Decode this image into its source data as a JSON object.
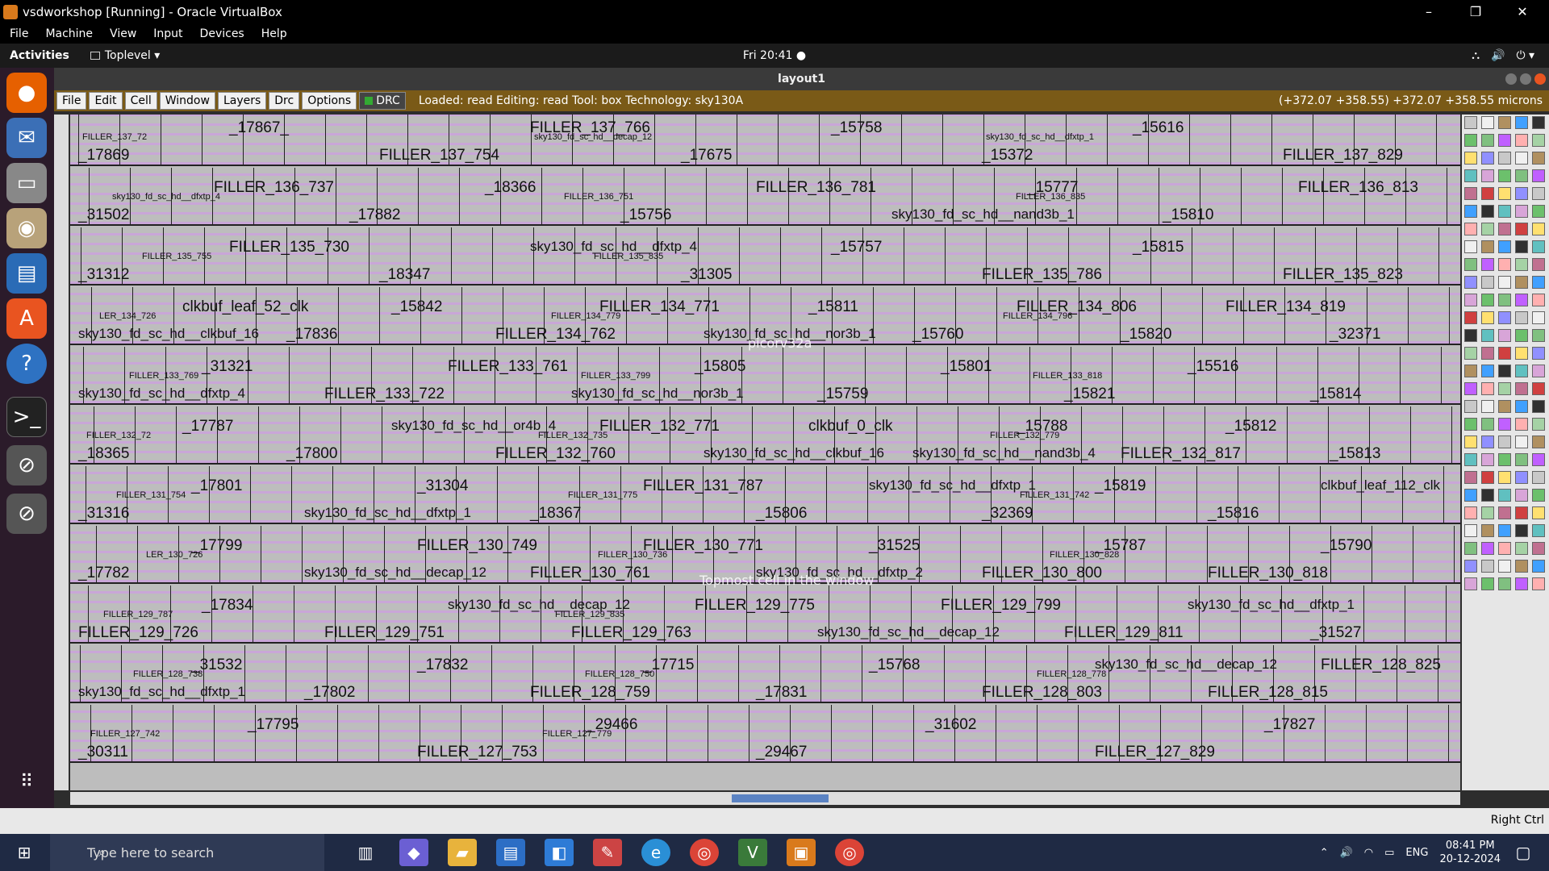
{
  "window": {
    "title": "vsdworkshop [Running] - Oracle VirtualBox",
    "minimize": "–",
    "maximize": "❐",
    "close": "✕"
  },
  "vb_menu": [
    "File",
    "Machine",
    "View",
    "Input",
    "Devices",
    "Help"
  ],
  "gnome": {
    "activities": "Activities",
    "toplevel": "Toplevel ▾",
    "clock": "Fri 20:41 ●",
    "sys_icons": [
      "⛬",
      "🔊",
      "⏻ ▾"
    ]
  },
  "magic": {
    "title": "layout1",
    "menu": [
      "File",
      "Edit",
      "Cell",
      "Window",
      "Layers",
      "Drc",
      "Options"
    ],
    "drc": "DRC",
    "status": "Loaded: read Editing: read Tool: box  Technology: sky130A",
    "coords": "(+372.07 +358.55) +372.07 +358.55 microns",
    "overlay_cell": "picorv32a",
    "overlay_hint": "Topmost cell in the window"
  },
  "rows": [
    {
      "big": [
        "_17869",
        "_17867_",
        "FILLER_137_754",
        "FILLER_137_766",
        "_17675",
        "_15758",
        "_15372",
        "_15616",
        "FILLER_137_829"
      ],
      "small": [
        "FILLER_137_72",
        "sky130_fd_sc_hd__decap_12",
        "sky130_fd_sc_hd__dfxtp_1"
      ]
    },
    {
      "big": [
        "_31502",
        "FILLER_136_737",
        "_17882",
        "_18366",
        "_15756",
        "FILLER_136_781",
        "sky130_fd_sc_hd__nand3b_1",
        "_15777",
        "_15810",
        "FILLER_136_813"
      ],
      "small": [
        "sky130_fd_sc_hd__dfxtp_4",
        "FILLER_136_751",
        "FILLER_136_835"
      ]
    },
    {
      "big": [
        "_31312",
        "FILLER_135_730",
        "_18347",
        "sky130_fd_sc_hd__dfxtp_4",
        "_31305",
        "_15757",
        "FILLER_135_786",
        "_15815",
        "FILLER_135_823"
      ],
      "small": [
        "FILLER_135_755",
        "FILLER_135_835"
      ]
    },
    {
      "big": [
        "sky130_fd_sc_hd__clkbuf_16",
        "clkbuf_leaf_52_clk",
        "_17836",
        "_15842",
        "FILLER_134_762",
        "FILLER_134_771",
        "sky130_fd_sc_hd__nor3b_1",
        "_15811",
        "_15760",
        "FILLER_134_806",
        "_15820",
        "FILLER_134_819",
        "_32371"
      ],
      "small": [
        "LER_134_726",
        "FILLER_134_779",
        "FILLER_134_796"
      ]
    },
    {
      "big": [
        "sky130_fd_sc_hd__dfxtp_4",
        "_31321",
        "FILLER_133_722",
        "FILLER_133_761",
        "sky130_fd_sc_hd__nor3b_1",
        "_15805",
        "_15759",
        "_15801",
        "_15821",
        "_15516",
        "_15814"
      ],
      "small": [
        "FILLER_133_769",
        "FILLER_133_799",
        "FILLER_133_818"
      ]
    },
    {
      "big": [
        "_18365",
        "_17787",
        "_17800",
        "sky130_fd_sc_hd__or4b_4",
        "FILLER_132_760",
        "FILLER_132_771",
        "sky130_fd_sc_hd__clkbuf_16",
        "clkbuf_0_clk",
        "sky130_fd_sc_hd__nand3b_4",
        "_15788",
        "FILLER_132_817",
        "_15812",
        "_15813"
      ],
      "small": [
        "FILLER_132_72",
        "FILLER_132_735",
        "FILLER_132_779"
      ]
    },
    {
      "big": [
        "_31316",
        "_17801",
        "sky130_fd_sc_hd__dfxtp_1",
        "_31304",
        "_18367",
        "FILLER_131_787",
        "_15806",
        "sky130_fd_sc_hd__dfxtp_1",
        "_32369",
        "_15819",
        "_15816",
        "clkbuf_leaf_112_clk"
      ],
      "small": [
        "FILLER_131_754",
        "FILLER_131_775",
        "FILLER_131_742"
      ]
    },
    {
      "big": [
        "_17782",
        "_17799",
        "sky130_fd_sc_hd__decap_12",
        "FILLER_130_749",
        "FILLER_130_761",
        "FILLER_130_771",
        "sky130_fd_sc_hd__dfxtp_2",
        "_31525",
        "FILLER_130_800",
        "_15787",
        "FILLER_130_818",
        "_15790"
      ],
      "small": [
        "LER_130_726",
        "FILLER_130_736",
        "FILLER_130_828"
      ]
    },
    {
      "big": [
        "FILLER_129_726",
        "_17834",
        "FILLER_129_751",
        "sky130_fd_sc_hd__decap_12",
        "FILLER_129_763",
        "FILLER_129_775",
        "sky130_fd_sc_hd__decap_12",
        "FILLER_129_799",
        "FILLER_129_811",
        "sky130_fd_sc_hd__dfxtp_1",
        "_31527"
      ],
      "small": [
        "FILLER_129_787",
        "FILLER_129_835"
      ]
    },
    {
      "big": [
        "sky130_fd_sc_hd__dfxtp_1",
        "_31532",
        "_17802",
        "_17832",
        "FILLER_128_759",
        "_17715",
        "_17831",
        "_15768",
        "FILLER_128_803",
        "sky130_fd_sc_hd__decap_12",
        "FILLER_128_815",
        "FILLER_128_825"
      ],
      "small": [
        "FILLER_128_738",
        "FILLER_128_750",
        "FILLER_128_778"
      ]
    },
    {
      "big": [
        "_30311",
        "_17795",
        "FILLER_127_753",
        "_29466",
        "_29467",
        "_31602",
        "FILLER_127_829",
        "_17827"
      ],
      "small": [
        "FILLER_127_742",
        "FILLER_127_779"
      ]
    }
  ],
  "vbox_status": {
    "right_ctrl": "Right Ctrl"
  },
  "taskbar": {
    "search_placeholder": "Type here to search",
    "time": "08:41 PM",
    "date": "20-12-2024",
    "lang": "ENG",
    "start": "⊞"
  }
}
